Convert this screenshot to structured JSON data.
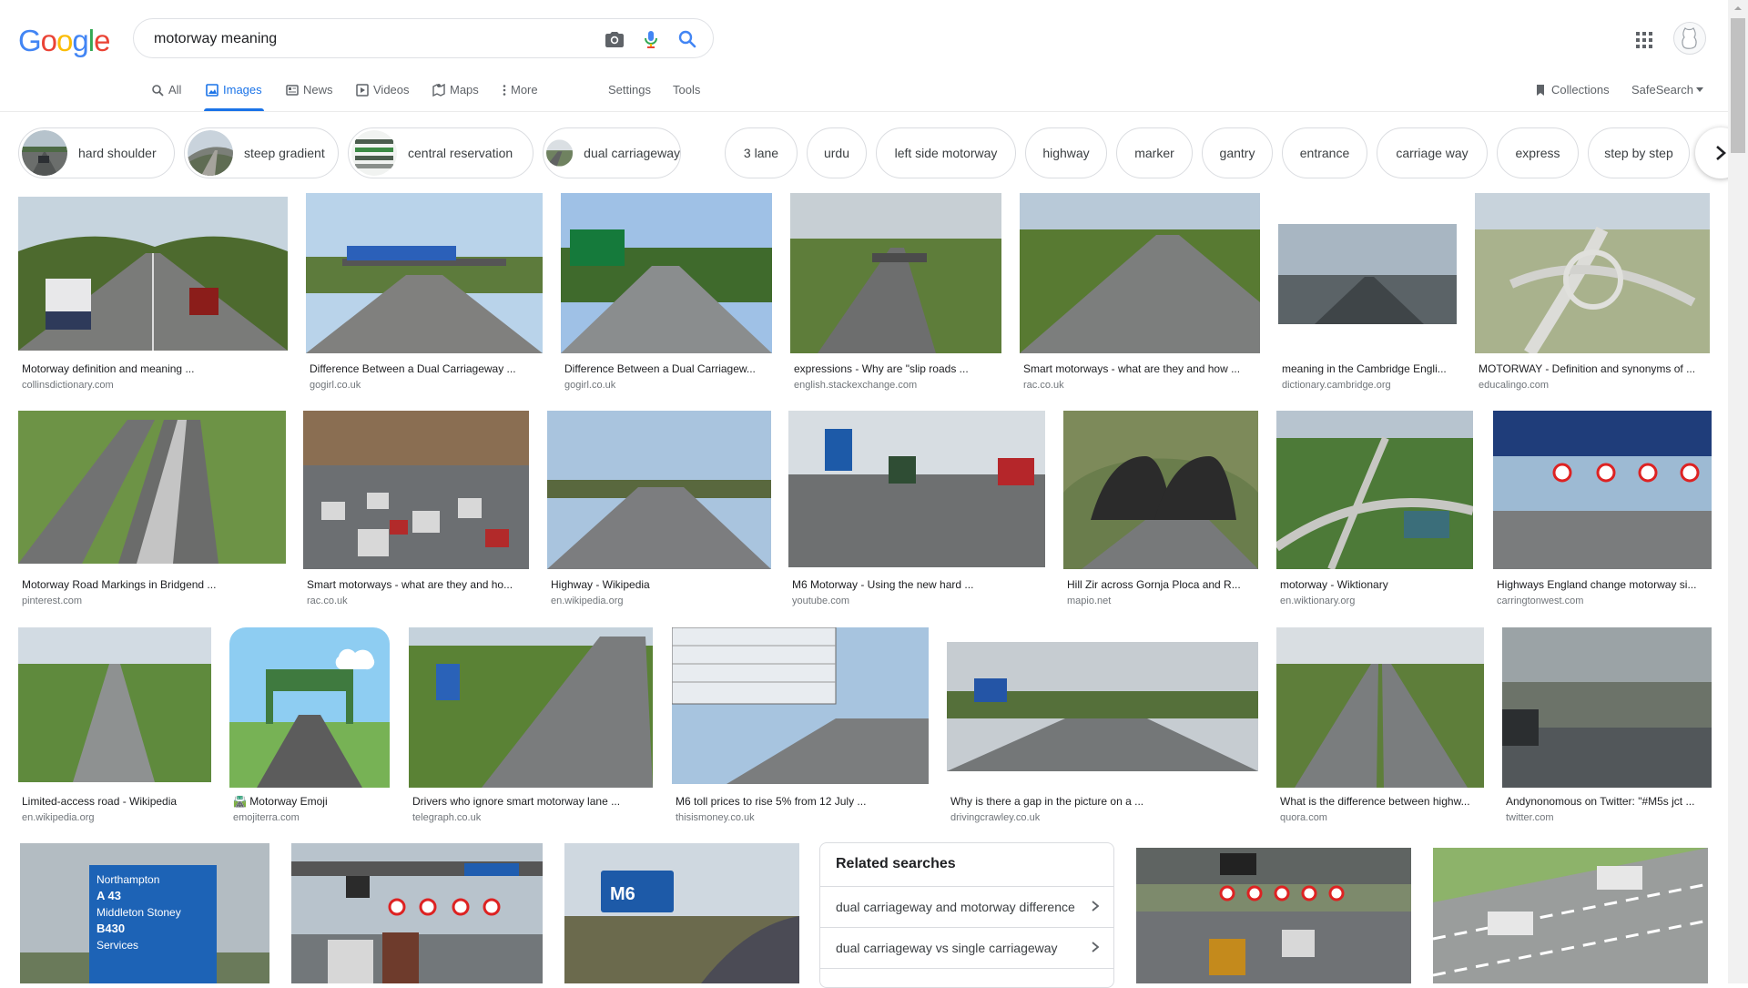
{
  "logo": {
    "letters": [
      "G",
      "o",
      "o",
      "g",
      "l",
      "e"
    ],
    "colors": [
      "#4285f4",
      "#ea4335",
      "#fbbc05",
      "#4285f4",
      "#34a853",
      "#ea4335"
    ]
  },
  "search": {
    "query": "motorway meaning"
  },
  "tabs": [
    {
      "label": "All",
      "icon": "search-icon"
    },
    {
      "label": "Images",
      "icon": "image-icon"
    },
    {
      "label": "News",
      "icon": "news-icon"
    },
    {
      "label": "Videos",
      "icon": "video-icon"
    },
    {
      "label": "Maps",
      "icon": "map-icon"
    },
    {
      "label": "More",
      "icon": "more-vert-icon"
    }
  ],
  "tools": {
    "settings": "Settings",
    "tools": "Tools",
    "collections": "Collections",
    "safesearch": "SafeSearch"
  },
  "chips": [
    "hard shoulder",
    "steep gradient",
    "central reservation",
    "dual carriageway",
    "3 lane",
    "urdu",
    "left side motorway",
    "highway",
    "marker",
    "gantry",
    "entrance",
    "carriage way",
    "express",
    "step by step"
  ],
  "results": [
    {
      "title": "Motorway definition and meaning ...",
      "source": "collinsdictionary.com"
    },
    {
      "title": "Difference Between a Dual Carriageway ...",
      "source": "gogirl.co.uk"
    },
    {
      "title": "Difference Between a Dual Carriagew...",
      "source": "gogirl.co.uk"
    },
    {
      "title": "expressions - Why are \"slip roads ...",
      "source": "english.stackexchange.com"
    },
    {
      "title": "Smart motorways - what are they and how ...",
      "source": "rac.co.uk"
    },
    {
      "title": "meaning in the Cambridge Engli...",
      "source": "dictionary.cambridge.org"
    },
    {
      "title": "MOTORWAY - Definition and synonyms of ...",
      "source": "educalingo.com"
    },
    {
      "title": "Motorway Road Markings in Bridgend ...",
      "source": "pinterest.com"
    },
    {
      "title": "Smart motorways - what are they and ho...",
      "source": "rac.co.uk"
    },
    {
      "title": "Highway - Wikipedia",
      "source": "en.wikipedia.org"
    },
    {
      "title": "M6 Motorway - Using the new hard ...",
      "source": "youtube.com"
    },
    {
      "title": "Hill Zir across Gornja Ploca and R...",
      "source": "mapio.net"
    },
    {
      "title": "motorway - Wiktionary",
      "source": "en.wiktionary.org"
    },
    {
      "title": "Highways England change motorway si...",
      "source": "carringtonwest.com"
    },
    {
      "title": "Limited-access road - Wikipedia",
      "source": "en.wikipedia.org"
    },
    {
      "title": "🛣️ Motorway Emoji",
      "source": "emojiterra.com"
    },
    {
      "title": "Drivers who ignore smart motorway lane ...",
      "source": "telegraph.co.uk"
    },
    {
      "title": "M6 toll prices to rise 5% from 12 July ...",
      "source": "thisismoney.co.uk"
    },
    {
      "title": "Why is there a gap in the picture on a ...",
      "source": "drivingcrawley.co.uk"
    },
    {
      "title": "What is the difference between highw...",
      "source": "quora.com"
    },
    {
      "title": "Andynonomous on Twitter: \"#M5s jct ...",
      "source": "twitter.com"
    }
  ],
  "thumbs_row4": [
    {
      "sign_lines": [
        "Northampton",
        "A 43",
        "Middleton Stoney",
        "B430",
        "Services"
      ]
    },
    {
      "sign_lines": []
    },
    {
      "sign_lines": [
        "M6"
      ]
    },
    {
      "sign_lines": []
    },
    {
      "sign_lines": []
    }
  ],
  "emoji_thumb_colors": {
    "sky": "#8ecdf2",
    "grass": "#77b255",
    "road": "#5c5c5c",
    "sign": "#3f7a3f"
  },
  "related": {
    "title": "Related searches",
    "items": [
      "dual carriageway and motorway difference",
      "dual carriageway vs single carriageway"
    ]
  },
  "accent": "#1a73e8"
}
